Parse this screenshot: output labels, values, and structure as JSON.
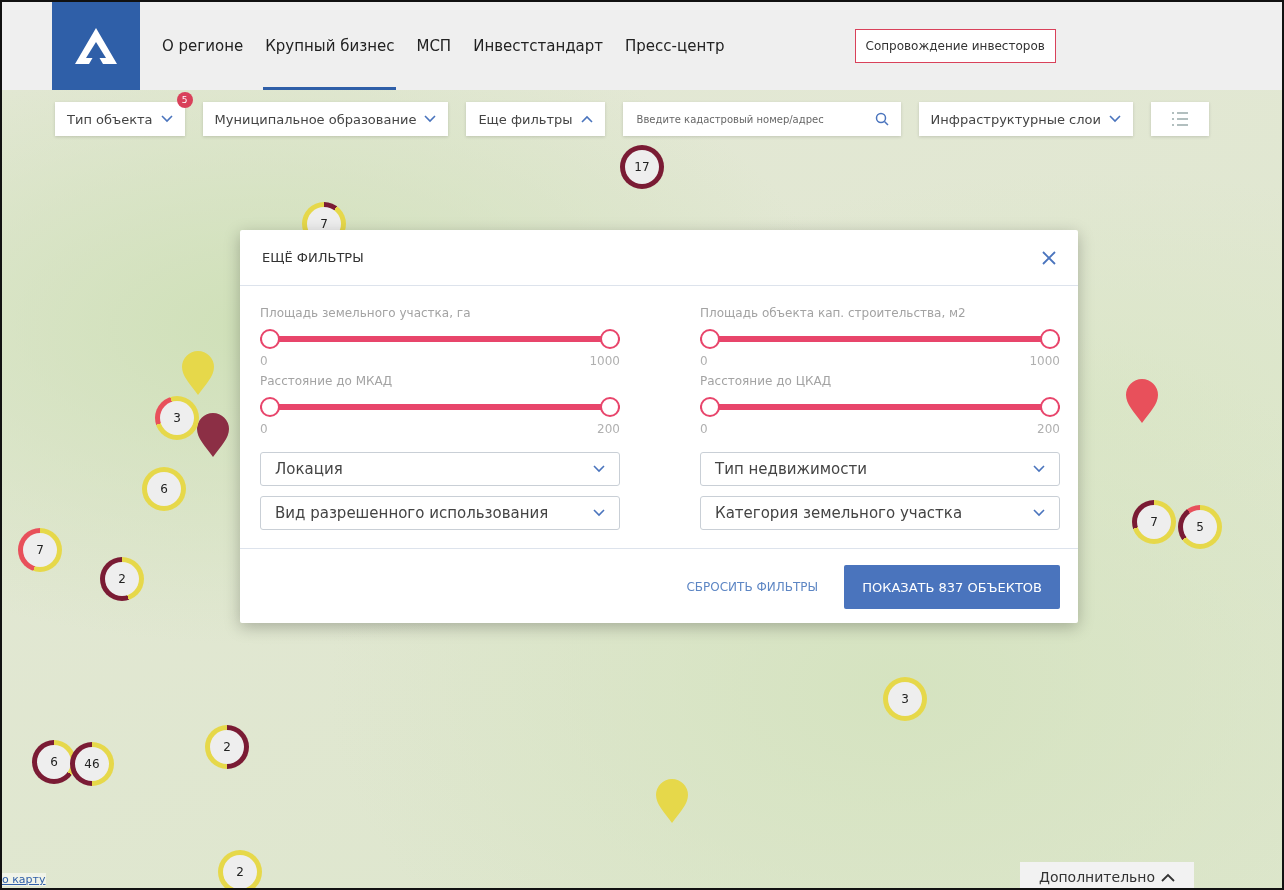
{
  "header": {
    "nav": [
      {
        "label": "О регионе",
        "selected": false
      },
      {
        "label": "Крупный бизнес",
        "selected": true
      },
      {
        "label": "МСП",
        "selected": false
      },
      {
        "label": "Инвестстандарт",
        "selected": false
      },
      {
        "label": "Пресс-центр",
        "selected": false
      }
    ],
    "cta": "Сопровождение инвесторов"
  },
  "filter_bar": {
    "dropdowns": [
      {
        "label": "Тип объекта",
        "badge": "5",
        "expanded": false
      },
      {
        "label": "Муниципальное образование",
        "expanded": false
      },
      {
        "label": "Еще фильтры",
        "expanded": true
      }
    ],
    "search": {
      "placeholder": "Введите кадастровый номер/адрес"
    },
    "layers": {
      "label": "Инфраструктурные слои",
      "expanded": false
    }
  },
  "map": {
    "clusters": [
      {
        "count": "17"
      },
      {
        "count": "7"
      },
      {
        "count": "3"
      },
      {
        "count": "6"
      },
      {
        "count": "7"
      },
      {
        "count": "2"
      },
      {
        "count": "2"
      },
      {
        "count": "6"
      },
      {
        "count": "46"
      },
      {
        "count": "2"
      },
      {
        "count": "3"
      },
      {
        "count": "7"
      },
      {
        "count": "5"
      }
    ],
    "pins": [
      {
        "color": "#e6d84a"
      },
      {
        "color": "#8c2f45"
      },
      {
        "color": "#e8505b"
      },
      {
        "color": "#e6d84a"
      }
    ],
    "link": "о карту",
    "more_button": "Дополнительно"
  },
  "modal": {
    "title": "ЕЩЁ ФИЛЬТРЫ",
    "sliders": [
      {
        "label": "Площадь земельного участка, га",
        "min": "0",
        "max": "1000",
        "level": 1
      },
      {
        "label": "Площадь объекта кап. строительства, м2",
        "min": "0",
        "max": "1000",
        "level": 1
      },
      {
        "label": "Расстояние до МКАД",
        "min": "0",
        "max": "200",
        "level": 1
      },
      {
        "label": "Расстояние до ЦКАД",
        "min": "0",
        "max": "200",
        "level": 1
      }
    ],
    "selects": [
      {
        "placeholder": "Локация"
      },
      {
        "placeholder": "Тип недвижимости"
      },
      {
        "placeholder": "Вид разрешенного использования"
      },
      {
        "placeholder": "Категория земельного участка"
      }
    ],
    "reset": "СБРОСИТЬ ФИЛЬТРЫ",
    "apply": "ПОКАЗАТЬ 837 ОБЪЕКТОВ"
  }
}
